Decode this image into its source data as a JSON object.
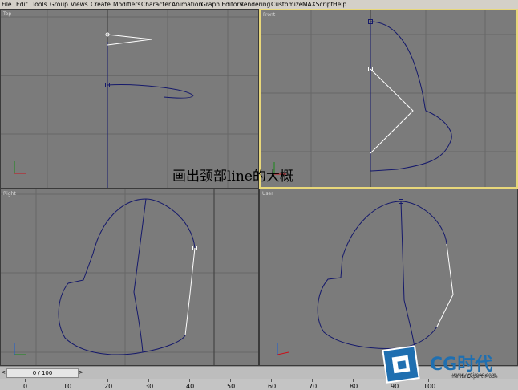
{
  "menu": {
    "items": [
      "File",
      "Edit",
      "Tools",
      "Group",
      "Views",
      "Create",
      "Modifiers",
      "Character",
      "Animation",
      "Graph Editors",
      "Rendering",
      "Customize",
      "MAXScript",
      "Help"
    ]
  },
  "viewports": {
    "top": {
      "label": "Top"
    },
    "front": {
      "label": "Front"
    },
    "left": {
      "label": "Right"
    },
    "user": {
      "label": "User"
    }
  },
  "caption": "画出颈部line的大概",
  "timeline": {
    "frame_display": "0 / 100",
    "prev_arrow": "<",
    "next_arrow": ">",
    "ruler_labels": [
      "0",
      "10",
      "20",
      "30",
      "40",
      "50",
      "60",
      "70",
      "80",
      "90",
      "100"
    ]
  },
  "logo": {
    "text": "CG时代",
    "sub": "www.cgtimes.com"
  },
  "status": {
    "text": "ments Expert Mode"
  },
  "colors": {
    "viewport_bg": "#7b7b7b",
    "grid": "#666666",
    "spline": "#15196b",
    "selected_spline": "#ffffff",
    "active_border": "#e8d77a"
  }
}
